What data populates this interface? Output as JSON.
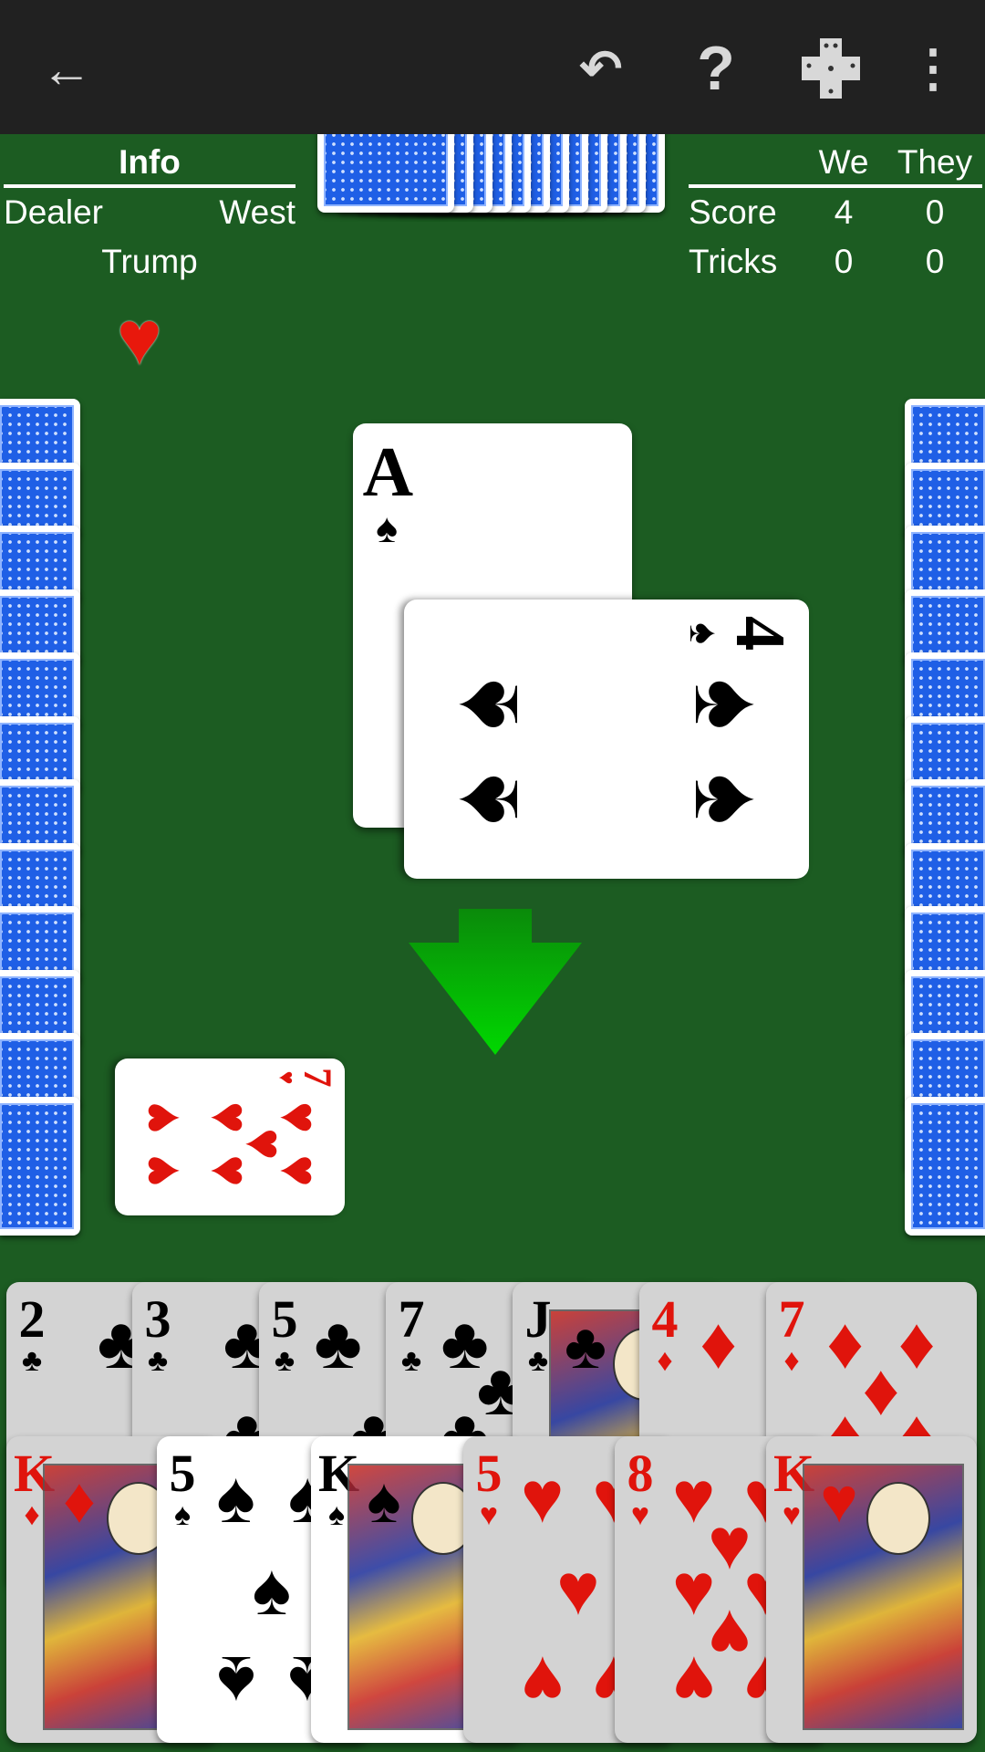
{
  "toolbar": {
    "icons": [
      "back-arrow-icon",
      "undo-icon",
      "help-icon",
      "cards-icon",
      "more-vert-icon"
    ],
    "help_glyph": "?",
    "back_glyph": "←",
    "undo_glyph": "↶",
    "more_glyph": "⋮"
  },
  "info": {
    "title": "Info",
    "dealer_label": "Dealer",
    "dealer_value": "West",
    "trump_label": "Trump",
    "trump_suit": "♥",
    "trump_color": "#e8180c"
  },
  "score": {
    "col_we": "We",
    "col_they": "They",
    "rows": [
      {
        "label": "Score",
        "we": "4",
        "they": "0"
      },
      {
        "label": "Tricks",
        "we": "0",
        "they": "0"
      }
    ]
  },
  "opponents": {
    "north_cards": 12,
    "west_cards": 12,
    "east_cards": 12,
    "back_color": "#1f5fe6"
  },
  "trick": [
    {
      "rank": "A",
      "suit": "♠",
      "player": "north"
    },
    {
      "rank": "4",
      "suit": "♠",
      "player": "east"
    },
    {
      "rank": "7",
      "suit": "♥",
      "player": "west"
    }
  ],
  "turn_indicator": {
    "direction": "down",
    "color": "#00c400"
  },
  "hand": {
    "row1": [
      {
        "rank": "2",
        "suit": "♣",
        "playable": false
      },
      {
        "rank": "3",
        "suit": "♣",
        "playable": false
      },
      {
        "rank": "5",
        "suit": "♣",
        "playable": false
      },
      {
        "rank": "7",
        "suit": "♣",
        "playable": false
      },
      {
        "rank": "J",
        "suit": "♣",
        "playable": false
      },
      {
        "rank": "4",
        "suit": "♦",
        "playable": false
      },
      {
        "rank": "7",
        "suit": "♦",
        "playable": false
      }
    ],
    "row2": [
      {
        "rank": "K",
        "suit": "♦",
        "playable": false
      },
      {
        "rank": "5",
        "suit": "♠",
        "playable": true
      },
      {
        "rank": "K",
        "suit": "♠",
        "playable": true
      },
      {
        "rank": "5",
        "suit": "♥",
        "playable": false
      },
      {
        "rank": "8",
        "suit": "♥",
        "playable": false
      },
      {
        "rank": "K",
        "suit": "♥",
        "playable": false
      }
    ]
  }
}
